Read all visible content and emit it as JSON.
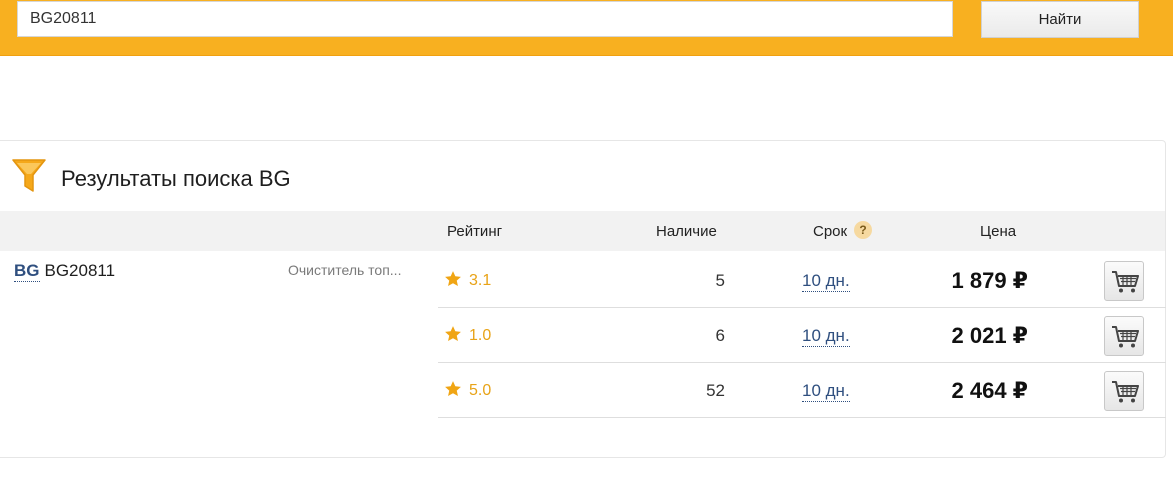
{
  "search": {
    "value": "BG20811",
    "button_label": "Найти"
  },
  "results": {
    "title": "Результаты поиска BG",
    "columns": {
      "rating": "Рейтинг",
      "stock": "Наличие",
      "term": "Срок",
      "term_help": "?",
      "price": "Цена"
    },
    "product": {
      "brand": "BG",
      "article": "BG20811",
      "description": "Очиститель топ..."
    },
    "offers": [
      {
        "rating": "3.1",
        "stock": "5",
        "term": "10 дн.",
        "price": "1 879 ₽"
      },
      {
        "rating": "1.0",
        "stock": "6",
        "term": "10 дн.",
        "price": "2 021 ₽"
      },
      {
        "rating": "5.0",
        "stock": "52",
        "term": "10 дн.",
        "price": "2 464 ₽"
      }
    ]
  },
  "icons": {
    "filter": "funnel-icon",
    "rating": "star-icon",
    "cart": "cart-icon",
    "help": "help-icon"
  },
  "colors": {
    "topbar": "#f8b020",
    "accent": "#e8a317",
    "link": "#2f4f7f"
  }
}
